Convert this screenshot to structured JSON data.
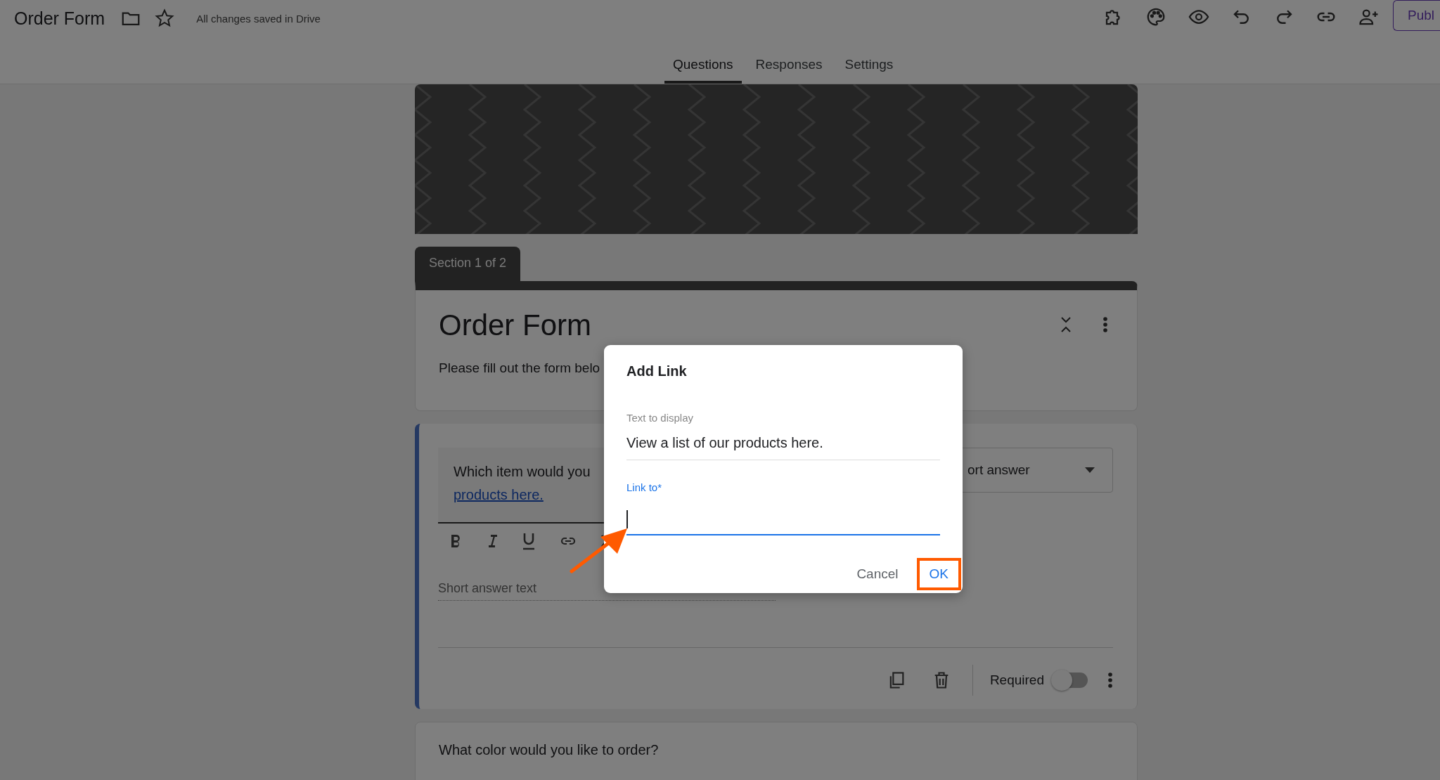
{
  "header": {
    "title": "Order Form",
    "save_status": "All changes saved in Drive",
    "publish_label": "Publ"
  },
  "tabs": [
    {
      "label": "Questions",
      "selected": true
    },
    {
      "label": "Responses",
      "selected": false
    },
    {
      "label": "Settings",
      "selected": false
    }
  ],
  "section_tab": "Section 1 of 2",
  "form_header": {
    "title": "Order Form",
    "description": "Please fill out the form belo"
  },
  "question": {
    "text": "Which item would you",
    "link_text": "products here.",
    "type": "ort answer",
    "answer_placeholder": "Short answer text",
    "required_label": "Required",
    "required": false
  },
  "next_question": {
    "text": "What color would you like to order?"
  },
  "dialog": {
    "title": "Add Link",
    "fields": [
      {
        "label": "Text to display",
        "value": "View a list of our products here.",
        "focused": false
      },
      {
        "label": "Link to*",
        "focused": true
      }
    ],
    "buttons": [
      {
        "label": "Cancel",
        "primary": false,
        "highlighted": false
      },
      {
        "label": "OK",
        "primary": true,
        "highlighted": true
      }
    ]
  }
}
